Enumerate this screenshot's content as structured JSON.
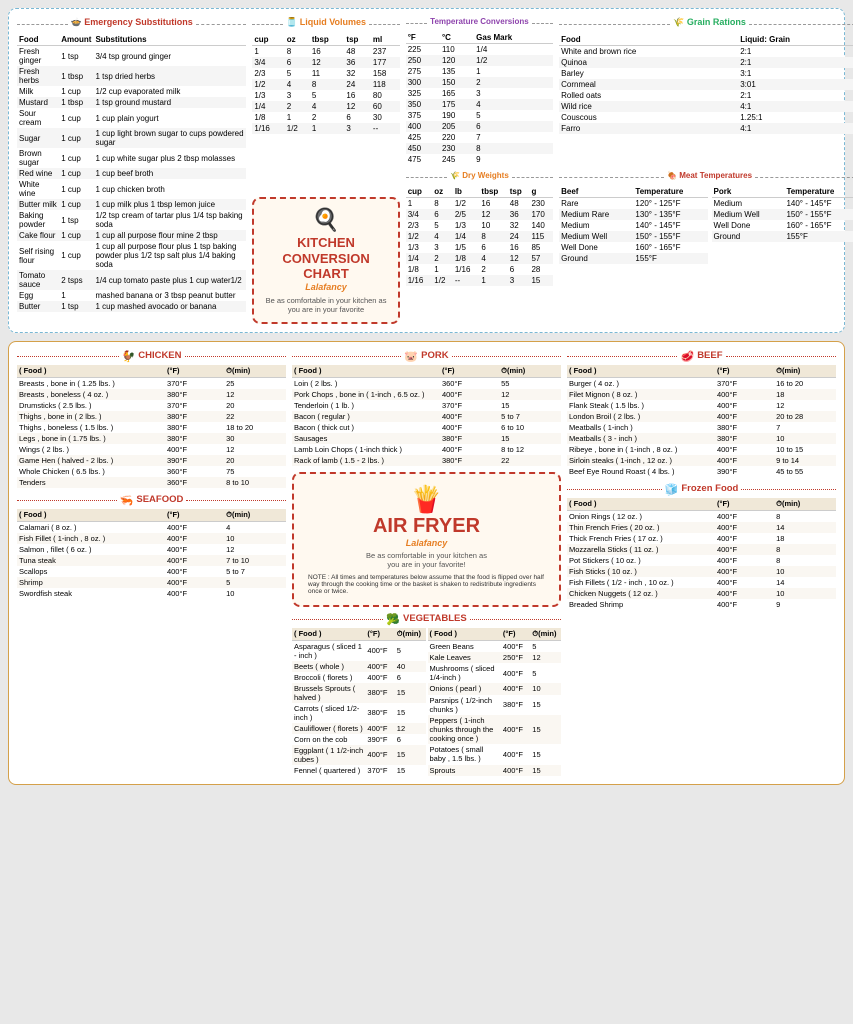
{
  "top": {
    "emergency": {
      "title": "🍲 Emergency Substitutions",
      "headers": [
        "Food",
        "Amount",
        "Substitutions"
      ],
      "rows": [
        [
          "Fresh ginger",
          "1 tsp",
          "3/4 tsp ground ginger"
        ],
        [
          "Fresh herbs",
          "1 tbsp",
          "1 tsp dried herbs"
        ],
        [
          "Milk",
          "1 cup",
          "1/2 cup evaporated milk"
        ],
        [
          "Mustard",
          "1 tbsp",
          "1 tsp ground mustard"
        ],
        [
          "Sour cream",
          "1 cup",
          "1 cup plain yogurt"
        ],
        [
          "Sugar",
          "1 cup",
          "1 cup light brown sugar to cups powdered sugar"
        ],
        [
          "Brown sugar",
          "1 cup",
          "1 cup white sugar plus 2 tbsp molasses"
        ],
        [
          "Red wine",
          "1 cup",
          "1 cup beef broth"
        ],
        [
          "White wine",
          "1 cup",
          "1 cup chicken broth"
        ],
        [
          "Butter milk",
          "1 cup",
          "1 cup milk plus 1 tbsp lemon juice"
        ],
        [
          "Baking powder",
          "1 tsp",
          "1/2 tsp cream of tartar plus 1/4 tsp baking soda"
        ],
        [
          "Cake flour",
          "1 cup",
          "1 cup all purpose flour mine 2 tbsp"
        ],
        [
          "Self rising flour",
          "1 cup",
          "1 cup all purpose flour plus 1 tsp baking powder plus 1/2 tsp salt plus 1/4 baking soda"
        ],
        [
          "Tomato sauce",
          "2 tsps",
          "1/4 cup tomato paste plus 1 cup water1/2"
        ],
        [
          "Egg",
          "1",
          "mashed banana or 3 tbsp peanut butter"
        ],
        [
          "Butter",
          "1 tsp",
          "1 cup mashed avocado or banana"
        ]
      ]
    },
    "liquid": {
      "title": "🫙 Liquid Volumes",
      "headers": [
        "cup",
        "oz",
        "tbsp",
        "tsp",
        "ml"
      ],
      "rows": [
        [
          "1",
          "8",
          "16",
          "48",
          "237"
        ],
        [
          "3/4",
          "6",
          "12",
          "36",
          "177"
        ],
        [
          "2/3",
          "5",
          "11",
          "32",
          "158"
        ],
        [
          "1/2",
          "4",
          "8",
          "24",
          "118"
        ],
        [
          "1/3",
          "3",
          "5",
          "16",
          "80"
        ],
        [
          "1/4",
          "2",
          "4",
          "12",
          "60"
        ],
        [
          "1/8",
          "1",
          "2",
          "6",
          "30"
        ],
        [
          "1/16",
          "1/2",
          "1",
          "3",
          "--"
        ]
      ]
    },
    "kitchen_chart": {
      "title": "KITCHEN CONVERSION\nCHART",
      "brand": "Lalafancy",
      "tagline": "Be as comfortable in your kitchen as\nyou are in your favorite"
    },
    "dry_weights": {
      "title": "🌾 Dry Weights",
      "headers": [
        "cup",
        "oz",
        "lb",
        "tbsp",
        "tsp",
        "g"
      ],
      "rows": [
        [
          "1",
          "8",
          "1/2",
          "16",
          "48",
          "230"
        ],
        [
          "3/4",
          "6",
          "2/5",
          "12",
          "36",
          "170"
        ],
        [
          "2/3",
          "5",
          "1/3",
          "10",
          "32",
          "140"
        ],
        [
          "1/2",
          "4",
          "1/4",
          "8",
          "24",
          "115"
        ],
        [
          "1/3",
          "3",
          "1/5",
          "6",
          "16",
          "85"
        ],
        [
          "1/4",
          "2",
          "1/8",
          "4",
          "12",
          "57"
        ],
        [
          "1/8",
          "1",
          "1/16",
          "2",
          "6",
          "28"
        ],
        [
          "1/16",
          "1/2",
          "--",
          "1",
          "3",
          "15"
        ]
      ]
    },
    "temp": {
      "title": "Temperature Conversions",
      "headers": [
        "°F",
        "°C",
        "Gas Mark"
      ],
      "rows": [
        [
          "225",
          "110",
          "1/4"
        ],
        [
          "250",
          "120",
          "1/2"
        ],
        [
          "275",
          "135",
          "1"
        ],
        [
          "300",
          "150",
          "2"
        ],
        [
          "325",
          "165",
          "3"
        ],
        [
          "350",
          "175",
          "4"
        ],
        [
          "375",
          "190",
          "5"
        ],
        [
          "400",
          "205",
          "6"
        ],
        [
          "425",
          "220",
          "7"
        ],
        [
          "450",
          "230",
          "8"
        ],
        [
          "475",
          "245",
          "9"
        ]
      ]
    },
    "grain": {
      "title": "🌾 Grain Rations",
      "headers": [
        "Food",
        "Liquid: Grain"
      ],
      "rows": [
        [
          "White and brown rice",
          "2:1"
        ],
        [
          "Quinoa",
          "2:1"
        ],
        [
          "Barley",
          "3:1"
        ],
        [
          "Cornmeal",
          "3:01"
        ],
        [
          "Rolled oats",
          "2:1"
        ],
        [
          "Wild rice",
          "4:1"
        ],
        [
          "Couscous",
          "1.25:1"
        ],
        [
          "Farro",
          "4:1"
        ]
      ]
    },
    "meat_temps": {
      "title": "🍖 Meat Temperatures",
      "headers_beef": [
        "Beef",
        "Temperature"
      ],
      "headers_pork": [
        "Pork",
        "Temperature"
      ],
      "beef_rows": [
        [
          "Rare",
          "120° - 125°F"
        ],
        [
          "Medium Rare",
          "130° - 135°F"
        ],
        [
          "Medium",
          "140° - 145°F"
        ],
        [
          "Medium Well",
          "150° - 155°F"
        ],
        [
          "Well Done",
          "160° - 165°F"
        ],
        [
          "Ground",
          "155°F"
        ]
      ],
      "pork_rows": [
        [
          "Medium",
          "140° - 145°F"
        ],
        [
          "Medium Well",
          "150° - 155°F"
        ],
        [
          "Well Done",
          "160° - 165°F"
        ],
        [
          "Ground",
          "155°F"
        ]
      ]
    }
  },
  "bottom": {
    "airfryer": {
      "title": "AIR FRYER",
      "brand": "Lalafancy",
      "tagline": "Be as comfortable in your kitchen as\nyou are in your favorite!",
      "note": "NOTE : All times and temperatures below assume that the food is flipped over half way through the cooking time or the basket is shaken to redistribute ingredients once or twice."
    },
    "chicken": {
      "title": "CHICKEN",
      "icon": "🐓",
      "headers": [
        "( Food )",
        "(°F)",
        "⏱(min)"
      ],
      "rows": [
        [
          "Breasts , bone in ( 1.25 lbs. )",
          "370°F",
          "25"
        ],
        [
          "Breasts , boneless ( 4 oz. )",
          "380°F",
          "12"
        ],
        [
          "Drumsticks ( 2.5 lbs. )",
          "370°F",
          "20"
        ],
        [
          "Thighs , bone in ( 2 lbs. )",
          "380°F",
          "22"
        ],
        [
          "Thighs , boneless ( 1.5 lbs. )",
          "380°F",
          "18 to 20"
        ],
        [
          "Legs , bone in ( 1.75 lbs. )",
          "380°F",
          "30"
        ],
        [
          "Wings ( 2 lbs. )",
          "400°F",
          "12"
        ],
        [
          "Game Hen ( halved - 2 lbs. )",
          "390°F",
          "20"
        ],
        [
          "Whole Chicken ( 6.5 lbs. )",
          "360°F",
          "75"
        ],
        [
          "Tenders",
          "360°F",
          "8 to 10"
        ]
      ]
    },
    "seafood": {
      "title": "SEAFOOD",
      "icon": "🦐",
      "headers": [
        "( Food )",
        "(°F)",
        "⏱(min)"
      ],
      "rows": [
        [
          "Calamari ( 8 oz. )",
          "400°F",
          "4"
        ],
        [
          "Fish Fillet ( 1-inch , 8 oz. )",
          "400°F",
          "10"
        ],
        [
          "Salmon , fillet ( 6 oz. )",
          "400°F",
          "12"
        ],
        [
          "Tuna steak",
          "400°F",
          "7 to 10"
        ],
        [
          "Scallops",
          "400°F",
          "5 to 7"
        ],
        [
          "Shrimp",
          "400°F",
          "5"
        ],
        [
          "Swordfish steak",
          "400°F",
          "10"
        ]
      ]
    },
    "pork": {
      "title": "PORK",
      "icon": "🐷",
      "headers": [
        "( Food )",
        "(°F)",
        "⏱(min)"
      ],
      "rows": [
        [
          "Loin ( 2 lbs. )",
          "360°F",
          "55"
        ],
        [
          "Pork Chops , bone in ( 1-inch , 6.5 oz. )",
          "400°F",
          "12"
        ],
        [
          "Tenderloin ( 1 lb. )",
          "370°F",
          "15"
        ],
        [
          "Bacon ( regular )",
          "400°F",
          "5 to 7"
        ],
        [
          "Bacon ( thick cut )",
          "400°F",
          "6 to 10"
        ],
        [
          "Sausages",
          "380°F",
          "15"
        ],
        [
          "Lamb Loin Chops ( 1-inch thick )",
          "400°F",
          "8 to 12"
        ],
        [
          "Rack of lamb ( 1.5 - 2 lbs. )",
          "380°F",
          "22"
        ]
      ]
    },
    "vegetables": {
      "title": "VEGETABLES",
      "icon": "🥦",
      "headers": [
        "( Food )",
        "(°F)",
        "⏱(min)"
      ],
      "rows": [
        [
          "Asparagus ( sliced 1 - inch )",
          "400°F",
          "5"
        ],
        [
          "Beets ( whole )",
          "400°F",
          "40"
        ],
        [
          "Broccoli ( florets )",
          "400°F",
          "6"
        ],
        [
          "Brussels Sprouts ( halved )",
          "380°F",
          "15"
        ],
        [
          "Carrots ( sliced 1/2-inch )",
          "380°F",
          "15"
        ],
        [
          "Cauliflower ( florets )",
          "400°F",
          "12"
        ],
        [
          "Corn on the cob",
          "390°F",
          "6"
        ],
        [
          "Eggplant ( 1 1/2-inch cubes )",
          "400°F",
          "15"
        ],
        [
          "Fennel ( quartered )",
          "370°F",
          "15"
        ],
        [
          "Green Beans",
          "400°F",
          "5"
        ],
        [
          "Kale Leaves",
          "250°F",
          "12"
        ],
        [
          "Mushrooms ( sliced 1/4-inch )",
          "400°F",
          "5"
        ],
        [
          "Onions ( pearl )",
          "400°F",
          "10"
        ],
        [
          "Parsnips ( 1/2-inch chunks )",
          "380°F",
          "15"
        ],
        [
          "Peppers ( 1-inch chunks through the cooking once )",
          "400°F",
          "15"
        ],
        [
          "Potatoes ( small baby , 1.5 lbs. )",
          "400°F",
          "15"
        ],
        [
          "Sprouts",
          "400°F",
          "15"
        ]
      ]
    },
    "beef": {
      "title": "BEEF",
      "icon": "🥩",
      "headers": [
        "( Food )",
        "(°F)",
        "⏱(min)"
      ],
      "rows": [
        [
          "Burger ( 4 oz. )",
          "370°F",
          "16 to 20"
        ],
        [
          "Filet Mignon ( 8 oz. )",
          "400°F",
          "18"
        ],
        [
          "Flank Steak ( 1.5 lbs. )",
          "400°F",
          "12"
        ],
        [
          "London Broil ( 2 lbs. )",
          "400°F",
          "20 to 28"
        ],
        [
          "Meatballs ( 1-inch )",
          "380°F",
          "7"
        ],
        [
          "Meatballs ( 3 - inch )",
          "380°F",
          "10"
        ],
        [
          "Ribeye , bone in ( 1-inch , 8 oz. )",
          "400°F",
          "10 to 15"
        ],
        [
          "Sirloin steaks ( 1-inch , 12 oz. )",
          "400°F",
          "9 to 14"
        ],
        [
          "Beef Eye Round Roast ( 4 lbs. )",
          "390°F",
          "45 to 55"
        ]
      ]
    },
    "frozen": {
      "title": "Frozen Food",
      "icon": "🧊",
      "headers": [
        "( Food )",
        "(°F)",
        "⏱(min)"
      ],
      "rows": [
        [
          "Onion Rings ( 12 oz. )",
          "400°F",
          "8"
        ],
        [
          "Thin French Fries ( 20 oz. )",
          "400°F",
          "14"
        ],
        [
          "Thick French Fries ( 17 oz. )",
          "400°F",
          "18"
        ],
        [
          "Mozzarella Sticks ( 11 oz. )",
          "400°F",
          "8"
        ],
        [
          "Pot Stickers ( 10 oz. )",
          "400°F",
          "8"
        ],
        [
          "Fish Sticks ( 10 oz. )",
          "400°F",
          "10"
        ],
        [
          "Fish Fillets ( 1/2 - inch , 10 oz. )",
          "400°F",
          "14"
        ],
        [
          "Chicken Nuggets ( 12 oz. )",
          "400°F",
          "10"
        ],
        [
          "Breaded Shrimp",
          "400°F",
          "9"
        ]
      ]
    }
  }
}
